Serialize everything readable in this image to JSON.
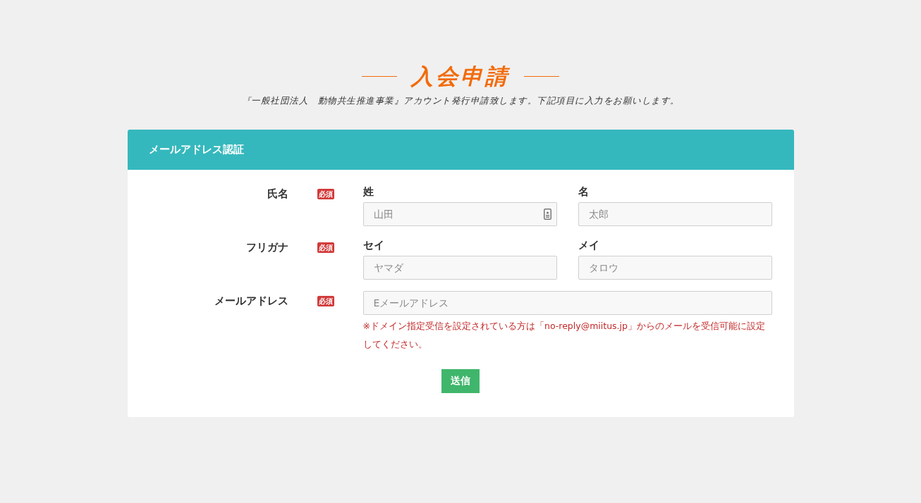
{
  "page": {
    "title": "入会申請",
    "subtitle": "『一般社団法人　動物共生推進事業』アカウント発行申請致します。下記項目に入力をお願いします。"
  },
  "card": {
    "header": "メールアドレス認証",
    "rows": [
      {
        "kind": "pair",
        "label": "氏名",
        "required": true,
        "required_badge": "必須",
        "fields": [
          {
            "label": "姓",
            "placeholder": "山田",
            "has_icon": true
          },
          {
            "label": "名",
            "placeholder": "太郎",
            "has_icon": false
          }
        ]
      },
      {
        "kind": "pair",
        "label": "フリガナ",
        "required": true,
        "required_badge": "必須",
        "fields": [
          {
            "label": "セイ",
            "placeholder": "ヤマダ",
            "has_icon": false
          },
          {
            "label": "メイ",
            "placeholder": "タロウ",
            "has_icon": false
          }
        ]
      },
      {
        "kind": "single",
        "label": "メールアドレス",
        "required": true,
        "required_badge": "必須",
        "placeholder": "Eメールアドレス",
        "note": "※ドメイン指定受信を設定されている方は「no-reply@miitus.jp」からのメールを受信可能に設定してください。"
      }
    ],
    "submit": "送信"
  }
}
